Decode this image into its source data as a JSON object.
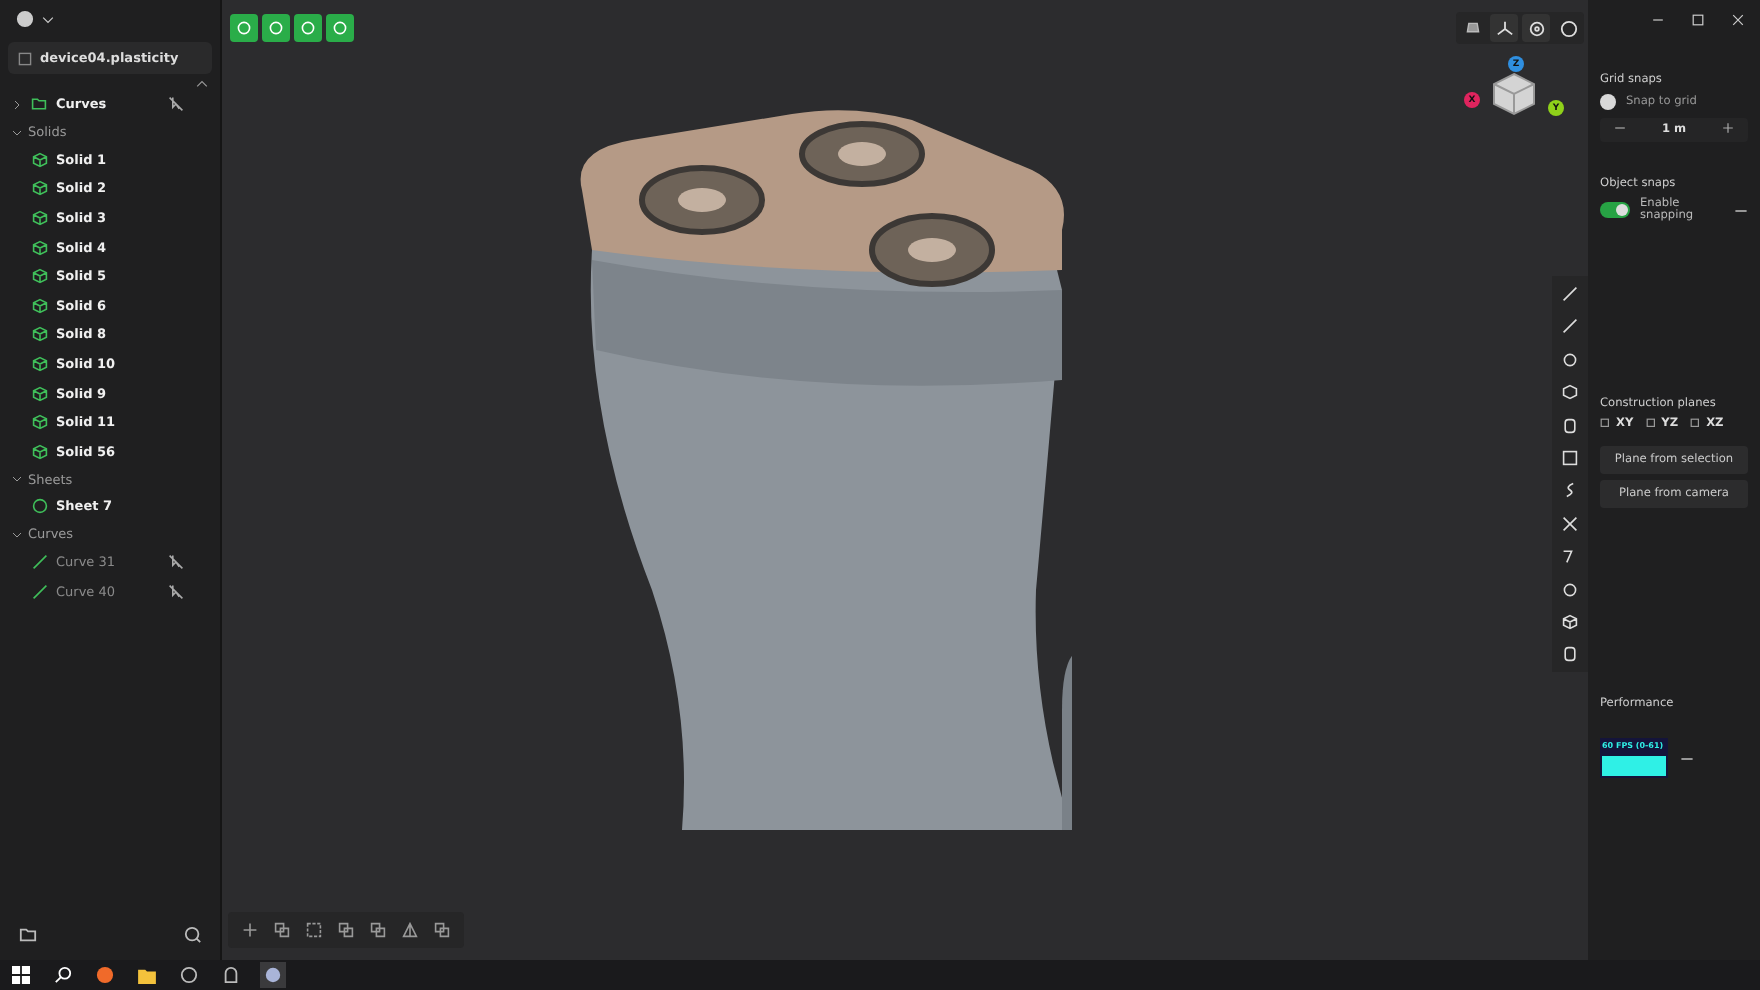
{
  "file": {
    "name": "device04.plasticity"
  },
  "outliner": [
    {
      "kind": "folder",
      "label": "Curves",
      "expanded": false,
      "selectable": false
    },
    {
      "kind": "section",
      "label": "Solids",
      "expanded": true,
      "children": [
        {
          "kind": "solid",
          "label": "Solid 1",
          "selectable": true
        },
        {
          "kind": "solid",
          "label": "Solid 2",
          "selectable": true
        },
        {
          "kind": "solid",
          "label": "Solid 3",
          "selectable": true
        },
        {
          "kind": "solid",
          "label": "Solid 4",
          "selectable": true
        },
        {
          "kind": "solid",
          "label": "Solid 5",
          "selectable": true
        },
        {
          "kind": "solid",
          "label": "Solid 6",
          "selectable": true
        },
        {
          "kind": "solid",
          "label": "Solid 8",
          "selectable": true
        },
        {
          "kind": "solid",
          "label": "Solid 10",
          "selectable": true
        },
        {
          "kind": "solid",
          "label": "Solid 9",
          "selectable": true
        },
        {
          "kind": "solid",
          "label": "Solid 11",
          "selectable": true
        },
        {
          "kind": "solid",
          "label": "Solid 56",
          "selectable": true
        }
      ]
    },
    {
      "kind": "section",
      "label": "Sheets",
      "expanded": true,
      "children": [
        {
          "kind": "sheet",
          "label": "Sheet 7",
          "selectable": true
        }
      ]
    },
    {
      "kind": "section",
      "label": "Curves",
      "expanded": true,
      "children": [
        {
          "kind": "curve",
          "label": "Curve 31",
          "selectable": false
        },
        {
          "kind": "curve",
          "label": "Curve 40",
          "selectable": false
        }
      ]
    }
  ],
  "gizmo": [
    {
      "label": "Z",
      "color": "#2f8fe0"
    },
    {
      "label": "X",
      "color": "#e0245e"
    },
    {
      "label": "Y",
      "color": "#8fd11a"
    }
  ],
  "grid_snaps": {
    "title": "Grid snaps",
    "snap": {
      "label": "Snap to grid",
      "on": false
    },
    "step": "1 m"
  },
  "object_snaps": {
    "title": "Object snaps",
    "snap": {
      "label": "Enable snapping",
      "on": true
    }
  },
  "construction_planes": {
    "title": "Construction planes",
    "planes": [
      "XY",
      "YZ",
      "XZ"
    ],
    "buttons": [
      "Plane from selection",
      "Plane from camera"
    ]
  },
  "performance": {
    "title": "Performance",
    "reading": "60 FPS (0-61)"
  }
}
